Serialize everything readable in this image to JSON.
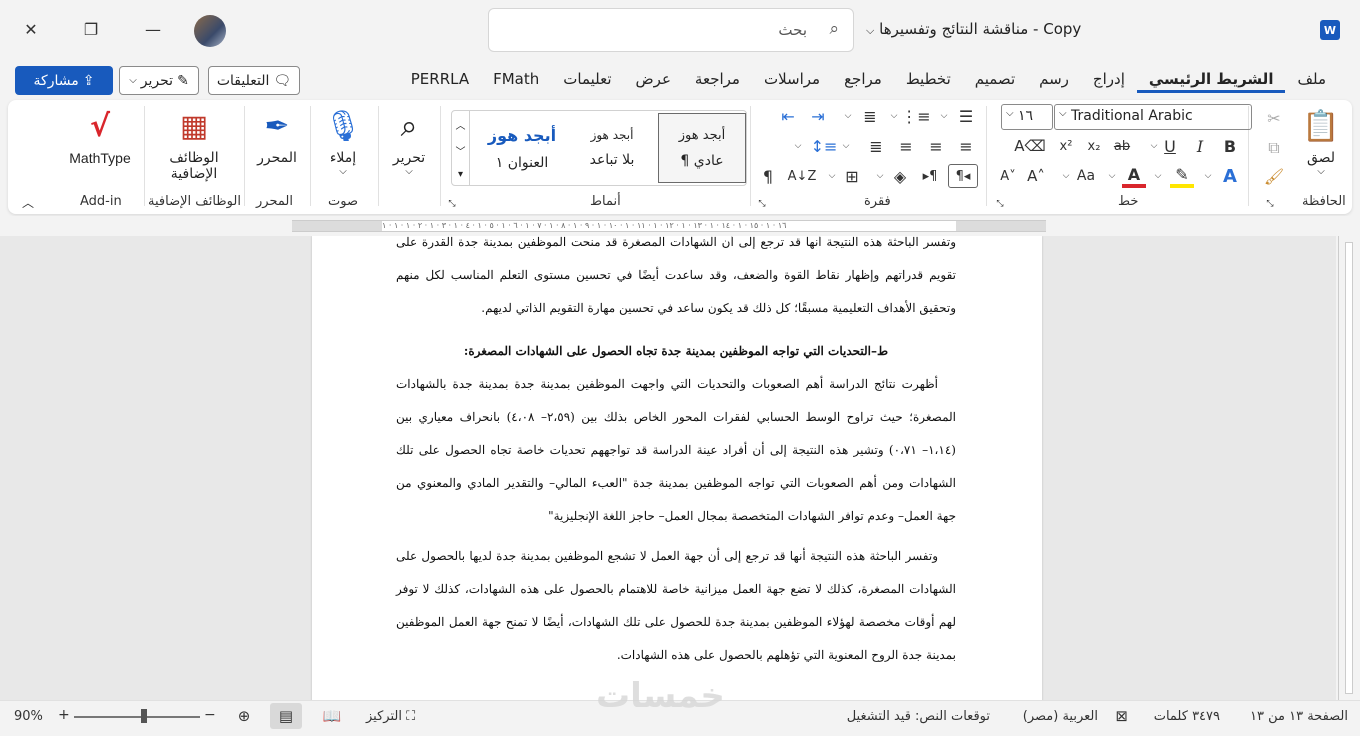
{
  "titlebar": {
    "doc_title": "مناقشة النتائج وتفسيرها - Copy",
    "search_placeholder": "بحث",
    "app_logo": "W"
  },
  "menu": {
    "tabs": [
      "ملف",
      "الشريط الرئيسي",
      "إدراج",
      "رسم",
      "تصميم",
      "تخطيط",
      "مراجع",
      "مراسلات",
      "مراجعة",
      "عرض",
      "تعليمات",
      "FMath",
      "PERRLA"
    ],
    "active": "الشريط الرئيسي",
    "share": "مشاركة",
    "edit": "تحرير",
    "comments": "التعليقات"
  },
  "ribbon": {
    "clipboard": {
      "paste": "لصق",
      "label": "الحافظة"
    },
    "font": {
      "name": "Traditional Arabic",
      "size": "١٦",
      "label": "خط"
    },
    "paragraph": {
      "label": "فقرة"
    },
    "styles": {
      "label": "أنماط",
      "items": [
        {
          "preview": "أبجد هوز",
          "name": "¶ عادي"
        },
        {
          "preview": "أبجد هوز",
          "name": "بلا تباعد"
        },
        {
          "preview": "أبجد هوز",
          "name": "العنوان ١"
        }
      ]
    },
    "editing": {
      "btn": "تحرير"
    },
    "voice": {
      "btn": "إملاء",
      "label": "صوت"
    },
    "editor": {
      "btn": "المحرر",
      "label": "المحرر"
    },
    "addins": {
      "btn1": "الوظائف",
      "btn2": "الإضافية",
      "label": "الوظائف الإضافية"
    },
    "mathtype": {
      "btn": "MathType",
      "label": "Add-in"
    }
  },
  "ruler_text": "١٦ · ١ · ١٥ · ١ · ١٤ · ١ · ١٣ · ١ · ١٢ · ١ · ١١ · ١ · ١٠ · ١ · ٩ · ١ · ٨ · ١ · ٧ · ١ · ٦ · ١ · ٥ · ١ · ٤ · ١ · ٣ · ١ · ٢ · ١ · ١ · ١",
  "document": {
    "para1": "وتفسر الباحثة هذه النتيجة أنها قد ترجع إلى أن الشهادات المصغرة قد منحت الموظفين بمدينة جدة القدرة على تقويم قدراتهم وإظهار نقاط القوة والضعف، وقد ساعدت أيضًا في تحسين مستوى التعلم المناسب لكل منهم وتحقيق الأهداف التعليمية مسبقًا؛ كل ذلك قد يكون ساعد في تحسين مهارة التقويم الذاتي لديهم.",
    "heading": "ط–التحديات التي تواجه الموظفين بمدينة جدة تجاه الحصول على الشهادات المصغرة:",
    "para2": "أظهرت نتائج الدراسة أهم الصعوبات والتحديات التي واجهت الموظفين بمدينة جدة بمدينة جدة بالشهادات المصغرة؛ حيث تراوح الوسط الحسابي لفقرات المحور الخاص بذلك بين (٢،٥٩– ٤،٠٨) بانحراف معياري بين (١،١٤– ٠،٧١) وتشير هذه النتيجة إلى أن أفراد عينة الدراسة قد تواجههم تحديات خاصة تجاه الحصول على تلك الشهادات ومن أهم الصعوبات التي تواجه الموظفين بمدينة جدة \"العبء المالي– والتقدير المادي والمعنوي من جهة العمل– وعدم توافر الشهادات المتخصصة بمجال العمل– حاجز اللغة الإنجليزية\"",
    "para3": "وتفسر الباحثة هذه النتيجة أنها قد ترجع إلى أن جهة العمل لا تشجع الموظفين بمدينة جدة لديها بالحصول على الشهادات المصغرة، كذلك لا تضع جهة العمل ميزانية خاصة للاهتمام بالحصول على هذه الشهادات، كذلك لا توفر لهم أوقات مخصصة لهؤلاء الموظفين بمدينة جدة للحصول على تلك الشهادات، أيضًا لا تمنح جهة العمل الموظفين بمدينة جدة الروح المعنوية التي تؤهلهم بالحصول على هذه الشهادات."
  },
  "status": {
    "page": "الصفحة ١٣ من ١٣",
    "words": "٣٤٧٩ كلمات",
    "language": "العربية (مصر)",
    "predictions": "توقعات النص: قيد التشغيل",
    "focus": "التركيز",
    "zoom": "90%",
    "zoom_level_percent": 90
  },
  "watermark": "خمسات",
  "colors": {
    "accent": "#185abd",
    "mathtype": "#d9262c",
    "addins": "#c0392b"
  }
}
